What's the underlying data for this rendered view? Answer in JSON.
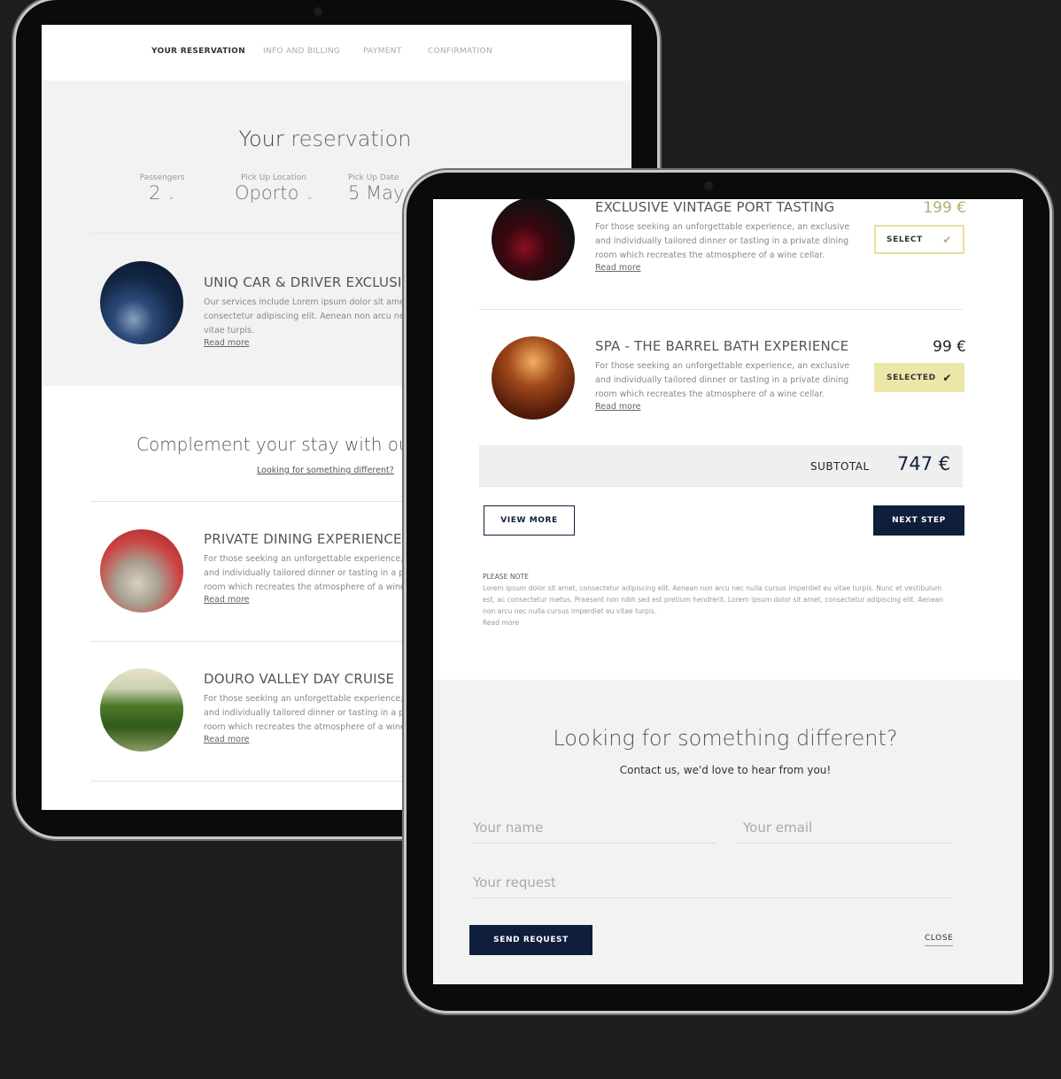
{
  "steps": [
    "YOUR RESERVATION",
    "INFO AND BILLING",
    "PAYMENT",
    "CONFIRMATION"
  ],
  "reservation": {
    "title_bold": "Your",
    "title_rest": " reservation",
    "fields": [
      {
        "label": "Passengers",
        "value": "2"
      },
      {
        "label": "Pick Up Location",
        "value": "Oporto"
      },
      {
        "label": "Pick Up Date",
        "value": "5 May"
      }
    ],
    "car": {
      "title": "UNIQ CAR & DRIVER EXCLUSIVE",
      "desc": "Our services include Lorem ipsum dolor sit amet, consectetur adipiscing elit. Aenean non arcu nec vitae turpis.",
      "read_more": "Read more"
    }
  },
  "complement": {
    "title": "Complement your stay with our e",
    "link": "Looking for something different?"
  },
  "experiences_left": [
    {
      "title": "PRIVATE DINING EXPERIENCE",
      "desc": "For those seeking an unforgettable experience, an exclusive and individually tailored dinner or tasting in a private dining room which recreates the atmosphere of a wine cellar.",
      "read_more": "Read more"
    },
    {
      "title": "DOURO VALLEY DAY CRUISE",
      "desc": "For those seeking an unforgettable experience, an exclusive and individually tailored dinner or tasting in a private dining room which recreates the atmosphere of a wine cellar.",
      "read_more": "Read more"
    }
  ],
  "experiences_right": [
    {
      "title": "EXCLUSIVE VINTAGE PORT TASTING",
      "price": "199 €",
      "desc": "For those seeking an unforgettable experience, an exclusive and individually tailored dinner or tasting in a private dining room which recreates the atmosphere of a wine cellar.",
      "read_more": "Read more",
      "button": "SELECT",
      "selected": false
    },
    {
      "title": "SPA - THE BARREL BATH EXPERIENCE",
      "price": "99 €",
      "desc": "For those seeking an unforgettable experience, an exclusive and individually tailored dinner or tasting in a private dining room which recreates the atmosphere of a wine cellar.",
      "read_more": "Read more",
      "button": "SELECTED",
      "selected": true
    }
  ],
  "subtotal": {
    "label": "SUBTOTAL",
    "value": "747 €"
  },
  "buttons": {
    "view_more": "VIEW MORE",
    "next_step": "NEXT STEP",
    "send_request": "SEND REQUEST",
    "close": "CLOSE"
  },
  "note": {
    "title": "PLEASE NOTE",
    "text": "Lorem ipsum dolor sit amet, consectetur adipiscing elit. Aenean non arcu nec nulla cursus imperdiet eu vitae turpis. Nunc et vestibulum est, ac consectetur metus. Praesent non nibh sed est pretium hendrerit. Lorem ipsum dolor sit amet, consectetur adipiscing elit. Aenean non arcu nec nulla cursus imperdiet eu vitae turpis.",
    "read_more": "Read more"
  },
  "contact": {
    "title": "Looking for something different?",
    "subtitle": "Contact us, we'd love to hear from you!",
    "name_placeholder": "Your name",
    "email_placeholder": "Your email",
    "request_placeholder": "Your request"
  },
  "colors": {
    "navy": "#0f1e3a",
    "gold": "#b5ad74",
    "selected_bg": "#ece6a8",
    "select_border": "#e8e0a0"
  }
}
